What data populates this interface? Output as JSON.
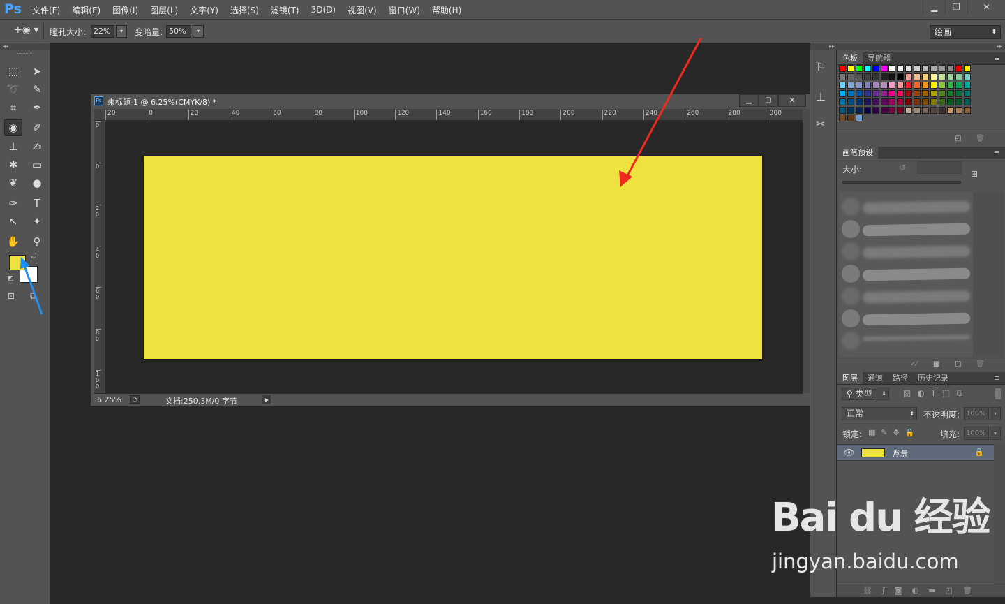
{
  "app": {
    "logo": "Ps"
  },
  "menu": [
    "文件(F)",
    "编辑(E)",
    "图像(I)",
    "图层(L)",
    "文字(Y)",
    "选择(S)",
    "滤镜(T)",
    "3D(D)",
    "视图(V)",
    "窗口(W)",
    "帮助(H)"
  ],
  "options": {
    "pupil_label": "瞳孔大小:",
    "pupil_value": "22%",
    "darken_label": "变暗量:",
    "darken_value": "50%",
    "workspace": "绘画"
  },
  "document": {
    "title": "未标题-1 @ 6.25%(CMYK/8) *",
    "zoom": "6.25%",
    "doc_info": "文档:250.3M/0 字节",
    "canvas_color": "#ede23f",
    "ruler_h": [
      "20",
      "0",
      "20",
      "40",
      "60",
      "80",
      "100",
      "120",
      "140",
      "160",
      "180",
      "200",
      "220",
      "240",
      "260",
      "280",
      "300"
    ],
    "ruler_v": [
      "0",
      "0",
      "2 0",
      "4 0",
      "6 0",
      "8 0",
      "1 0 0"
    ]
  },
  "colors": {
    "foreground": "#ede23f",
    "background": "#ffffff",
    "annotation_red": "#ee2a1f",
    "annotation_blue": "#1e8ff0"
  },
  "panels": {
    "swatch_tabs": [
      "色板",
      "导航器"
    ],
    "brush_tab": "画笔预设",
    "brush_size_label": "大小:",
    "layer_tabs": [
      "图层",
      "通道",
      "路径",
      "历史记录"
    ],
    "layer_filter": "类型",
    "blend_mode": "正常",
    "opacity_label": "不透明度:",
    "opacity_value": "100%",
    "lock_label": "锁定:",
    "fill_label": "填充:",
    "fill_value": "100%",
    "layer_name": "背景",
    "layer_thumb_color": "#ede23f"
  },
  "watermark": {
    "text": "Bai du 经验",
    "url": "jingyan.baidu.com"
  }
}
